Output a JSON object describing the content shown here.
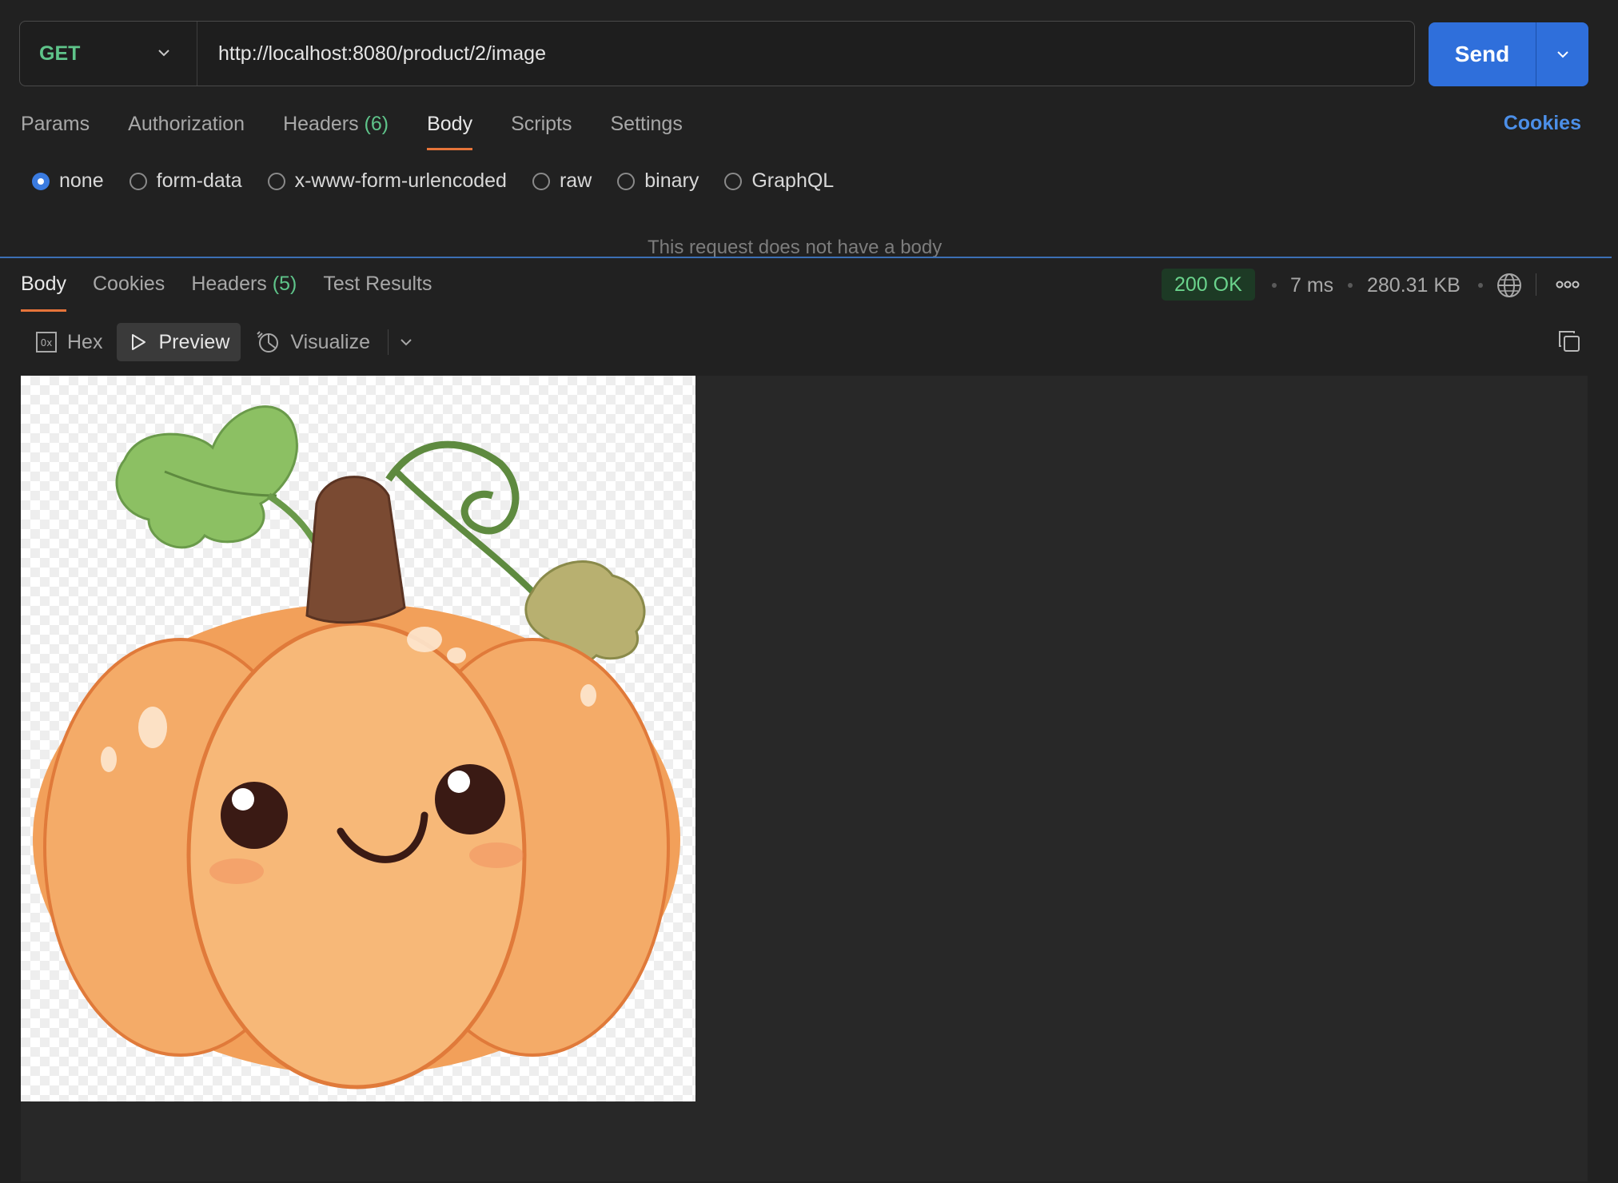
{
  "request": {
    "method": "GET",
    "url": "http://localhost:8080/product/2/image",
    "send_label": "Send"
  },
  "request_tabs": [
    {
      "label": "Params"
    },
    {
      "label": "Authorization"
    },
    {
      "label": "Headers",
      "count": "(6)"
    },
    {
      "label": "Body",
      "active": true
    },
    {
      "label": "Scripts"
    },
    {
      "label": "Settings"
    }
  ],
  "cookies_link": "Cookies",
  "body_types": [
    {
      "label": "none",
      "checked": true
    },
    {
      "label": "form-data"
    },
    {
      "label": "x-www-form-urlencoded"
    },
    {
      "label": "raw"
    },
    {
      "label": "binary"
    },
    {
      "label": "GraphQL"
    }
  ],
  "no_body_message": "This request does not have a body",
  "response": {
    "tabs": [
      {
        "label": "Body",
        "active": true
      },
      {
        "label": "Cookies"
      },
      {
        "label": "Headers",
        "count": "(5)"
      },
      {
        "label": "Test Results"
      }
    ],
    "status": "200 OK",
    "time": "7 ms",
    "size": "280.31 KB",
    "view_modes": [
      {
        "label": "Hex",
        "icon": "hex-icon"
      },
      {
        "label": "Preview",
        "icon": "play-icon",
        "active": true
      },
      {
        "label": "Visualize",
        "icon": "visualize-icon"
      }
    ],
    "preview_image": "pumpkin-image"
  },
  "colors": {
    "accent": "#e6743a",
    "send": "#2f6fdb",
    "method": "#5fc48a",
    "status_bg": "#1d3a25",
    "link": "#4c8fe8"
  }
}
